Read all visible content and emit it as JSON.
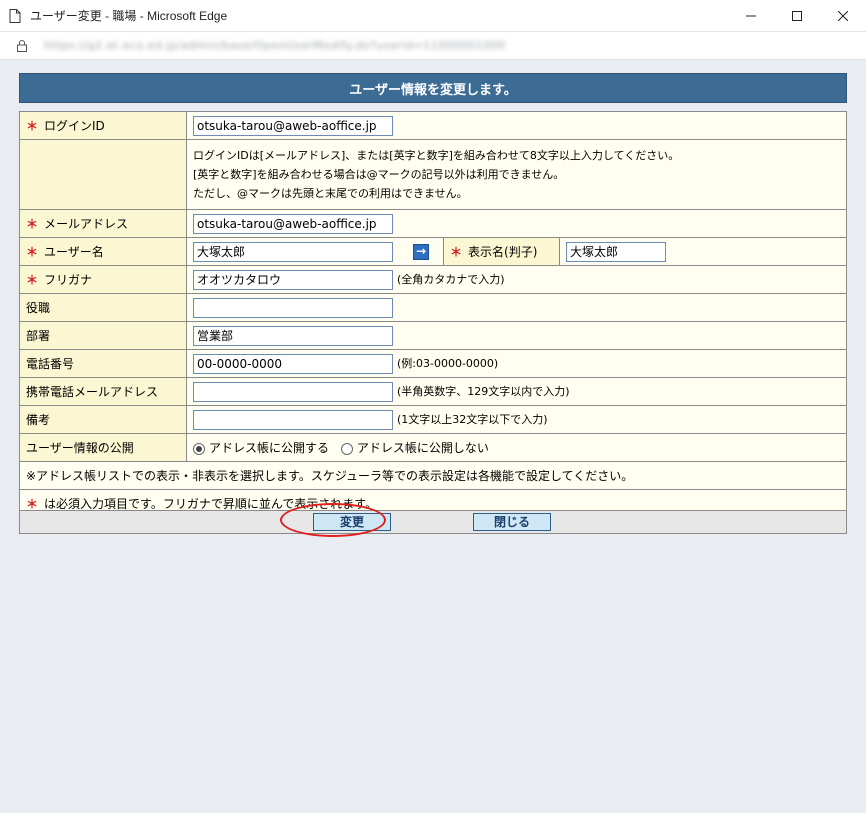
{
  "window": {
    "title": "ユーザー変更 - 職場 - Microsoft Edge",
    "url": "https://g2.et.eco.ed.jp/admin/base/OpenUserModify.do?userid=11000001000"
  },
  "form": {
    "header": "ユーザー情報を変更します。",
    "required_mark": "＊",
    "login_id": {
      "label": "ログインID",
      "value": "otsuka-tarou@aweb-aoffice.jp"
    },
    "login_info": [
      "ログインIDは[メールアドレス]、または[英字と数字]を組み合わせて8文字以上入力してください。",
      "[英字と数字]を組み合わせる場合は@マークの記号以外は利用できません。",
      "ただし、@マークは先頭と末尾での利用はできません。"
    ],
    "email": {
      "label": "メールアドレス",
      "value": "otsuka-tarou@aweb-aoffice.jp"
    },
    "username": {
      "label": "ユーザー名",
      "value": "大塚太郎"
    },
    "display_name": {
      "label": "表示名(判子)",
      "value": "大塚太郎"
    },
    "furigana": {
      "label": "フリガナ",
      "value": "オオツカタロウ",
      "hint": "(全角カタカナで入力)"
    },
    "position": {
      "label": "役職",
      "value": ""
    },
    "department": {
      "label": "部署",
      "value": "営業部"
    },
    "phone": {
      "label": "電話番号",
      "value": "00-0000-0000",
      "hint": "(例:03-0000-0000)"
    },
    "mobile_email": {
      "label": "携帯電話メールアドレス",
      "value": "",
      "hint": "(半角英数字、129文字以内で入力)"
    },
    "note": {
      "label": "備考",
      "value": "",
      "hint": "(1文字以上32文字以下で入力)"
    },
    "publish": {
      "label": "ユーザー情報の公開",
      "option_public": "アドレス帳に公開する",
      "option_private": "アドレス帳に公開しない",
      "selected": "public"
    },
    "address_note": "※アドレス帳リストでの表示・非表示を選択します。スケジューラ等での表示設定は各機能で設定してください。",
    "required_note": "は必須入力項目です。フリガナで昇順に並んで表示されます。",
    "buttons": {
      "change": "変更",
      "close": "閉じる"
    }
  },
  "colors": {
    "header_bg": "#3c6b94",
    "label_bg": "#fbf7d2",
    "required": "#d21f1f",
    "highlight": "#e0201d"
  }
}
